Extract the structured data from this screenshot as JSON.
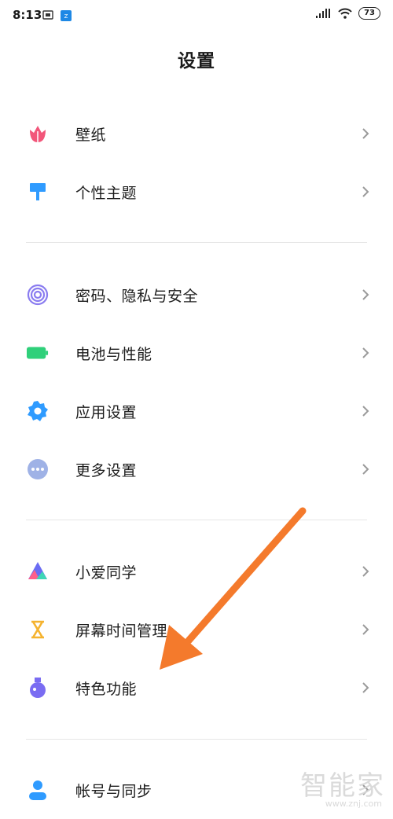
{
  "status_bar": {
    "time": "8:13",
    "battery": "73"
  },
  "header": {
    "title": "设置"
  },
  "groups": [
    {
      "items": [
        {
          "label": "壁纸",
          "icon": "tulip-icon",
          "color": "#f2567a"
        },
        {
          "label": "个性主题",
          "icon": "paint-roller-icon",
          "color": "#2f9bff"
        }
      ]
    },
    {
      "items": [
        {
          "label": "密码、隐私与安全",
          "icon": "fingerprint-icon",
          "color": "#8a7cf0"
        },
        {
          "label": "电池与性能",
          "icon": "battery-icon",
          "color": "#2fd07a"
        },
        {
          "label": "应用设置",
          "icon": "gear-icon",
          "color": "#2f9bff"
        },
        {
          "label": "更多设置",
          "icon": "more-dots-icon",
          "color": "#9fb2e6"
        }
      ]
    },
    {
      "items": [
        {
          "label": "小爱同学",
          "icon": "xiaoai-icon",
          "color": "#6a6cf3"
        },
        {
          "label": "屏幕时间管理",
          "icon": "hourglass-icon",
          "color": "#f5b32f"
        },
        {
          "label": "特色功能",
          "icon": "flask-icon",
          "color": "#7a6cf2"
        }
      ]
    },
    {
      "items": [
        {
          "label": "帐号与同步",
          "icon": "user-icon",
          "color": "#2f9bff"
        }
      ]
    }
  ],
  "annotation": {
    "arrow_color": "#f47a2c"
  },
  "watermark": {
    "text": "智能家",
    "url": "www.znj.com"
  }
}
